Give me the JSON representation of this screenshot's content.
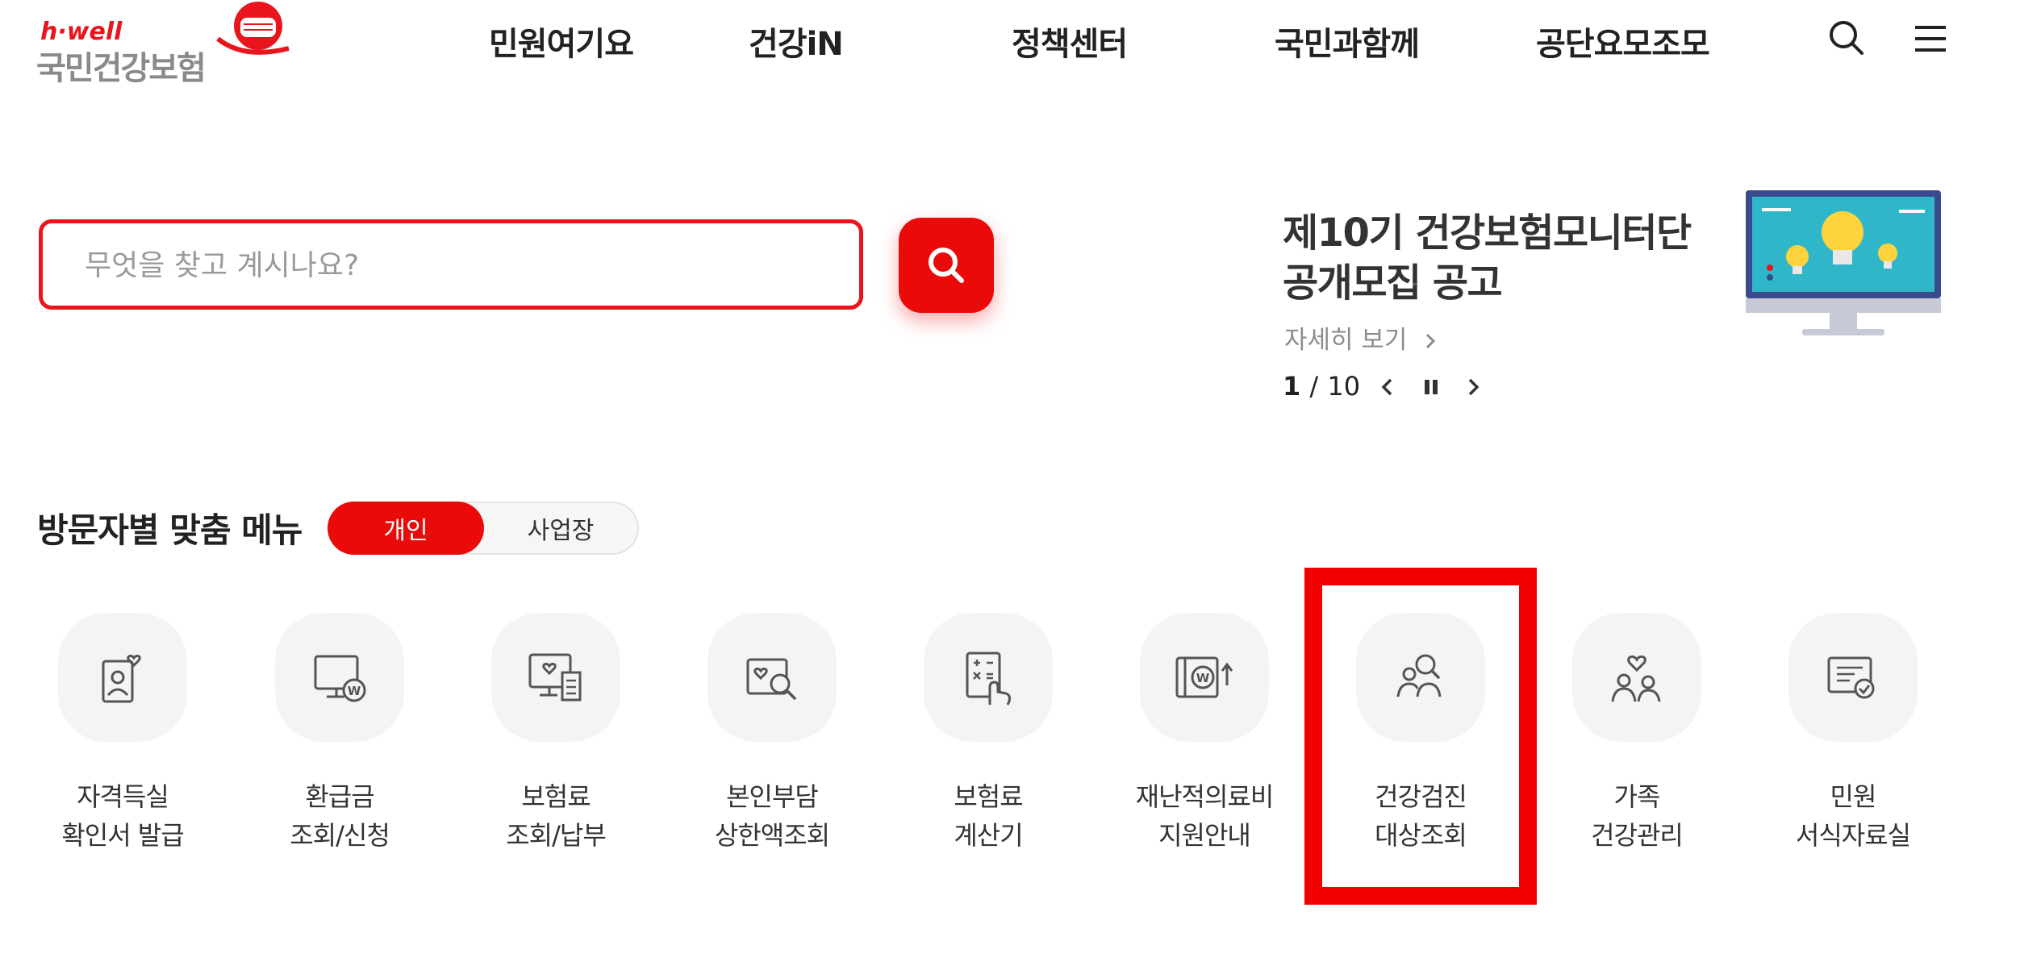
{
  "header": {
    "logo_en": "h·well",
    "logo_ko": "국민건강보험",
    "nav": [
      "민원여기요",
      "건강iN",
      "정책센터",
      "국민과함께",
      "공단요모조모"
    ],
    "icons": [
      "search-icon",
      "menu-icon"
    ]
  },
  "search": {
    "placeholder": "무엇을 찾고 계시나요?",
    "button_icon": "search-icon"
  },
  "banner": {
    "title_line1": "제10기 건강보험모니터단",
    "title_line2": "공개모집 공고",
    "more": "자세히 보기",
    "current": "1",
    "separator": "/",
    "total": "10"
  },
  "visitor_menu": {
    "title": "방문자별 맞춤 메뉴",
    "tabs": [
      "개인",
      "사업장"
    ],
    "active_tab": "개인",
    "items": [
      {
        "line1": "자격득실",
        "line2": "확인서 발급",
        "icon": "id-card-heart-icon"
      },
      {
        "line1": "환급금",
        "line2": "조회/신청",
        "icon": "monitor-won-icon"
      },
      {
        "line1": "보험료",
        "line2": "조회/납부",
        "icon": "monitor-receipt-icon"
      },
      {
        "line1": "본인부담",
        "line2": "상한액조회",
        "icon": "card-search-icon"
      },
      {
        "line1": "보험료",
        "line2": "계산기",
        "icon": "calculator-hand-icon"
      },
      {
        "line1": "재난적의료비",
        "line2": "지원안내",
        "icon": "book-won-icon"
      },
      {
        "line1": "건강검진",
        "line2": "대상조회",
        "icon": "people-search-icon"
      },
      {
        "line1": "가족",
        "line2": "건강관리",
        "icon": "family-heart-icon"
      },
      {
        "line1": "민원",
        "line2": "서식자료실",
        "icon": "document-check-icon"
      }
    ]
  },
  "colors": {
    "accent": "#ea0a0a",
    "highlight": "#f20000",
    "text": "#333333",
    "icon_bg": "#f4f4f4"
  }
}
